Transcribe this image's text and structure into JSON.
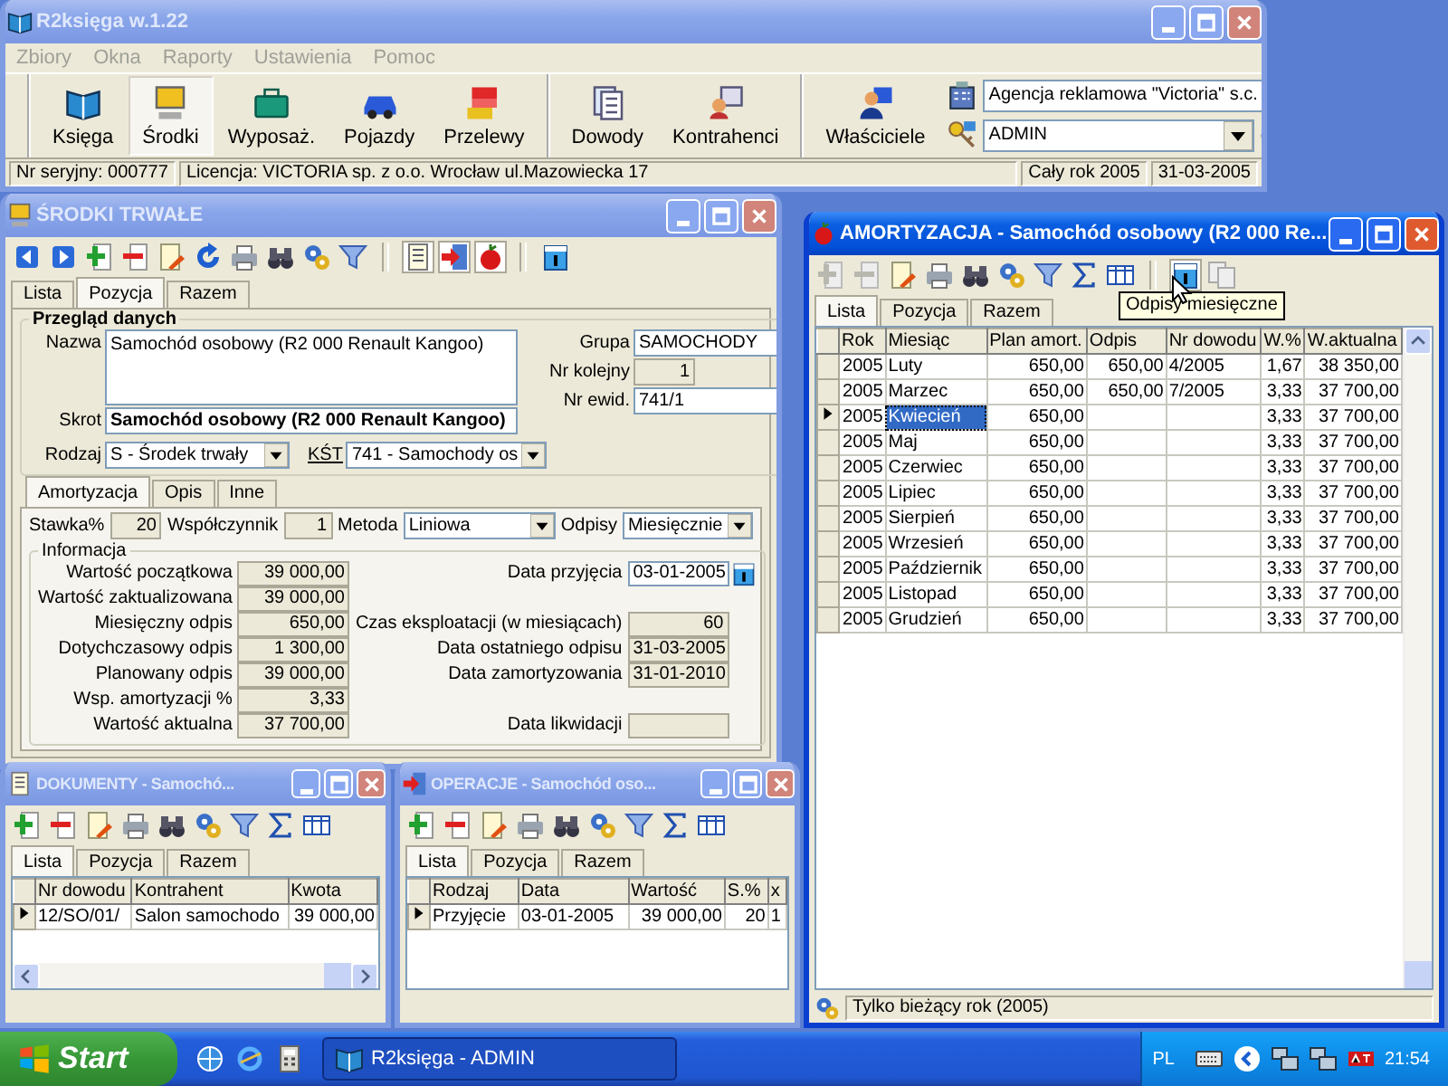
{
  "main_window": {
    "title": "R2księga w.1.22",
    "active": false,
    "menu": [
      {
        "label": "Zbiory",
        "disabled": true
      },
      {
        "label": "Okna",
        "disabled": true
      },
      {
        "label": "Raporty",
        "disabled": true
      },
      {
        "label": "Ustawienia",
        "disabled": true
      },
      {
        "label": "Pomoc",
        "disabled": true
      }
    ],
    "toolbar_groups": [
      [
        {
          "label": "Księga",
          "selected": false
        },
        {
          "label": "Środki",
          "selected": true
        },
        {
          "label": "Wyposaż.",
          "selected": false
        },
        {
          "label": "Pojazdy",
          "selected": false
        },
        {
          "label": "Przelewy",
          "selected": false
        }
      ],
      [
        {
          "label": "Dowody",
          "selected": false
        },
        {
          "label": "Kontrahenci",
          "selected": false
        }
      ],
      [
        {
          "label": "Właściciele",
          "selected": false
        }
      ]
    ],
    "company_select": "Agencja reklamowa \"Victoria\" s.c.",
    "user_select": "ADMIN",
    "status_bar": [
      "Nr seryjny: 000777",
      "Licencja: VICTORIA sp. z o.o. Wrocław ul.Mazowiecka 17",
      "Cały rok 2005",
      "31-03-2005"
    ]
  },
  "srodki_window": {
    "title": "ŚRODKI TRWAŁE",
    "active": false,
    "tabs": [
      {
        "label": "Lista",
        "selected": false
      },
      {
        "label": "Pozycja",
        "selected": true
      },
      {
        "label": "Razem",
        "selected": false
      }
    ],
    "section_title": "Przegląd danych",
    "nazwa": {
      "label": "Nazwa",
      "value": "Samochód osobowy (R2 000 Renault Kangoo)"
    },
    "skrot": {
      "label": "Skrot",
      "value": "Samochód osobowy (R2 000 Renault Kangoo)"
    },
    "grupa": {
      "label": "Grupa",
      "value": "SAMOCHODY"
    },
    "nr_kolejny": {
      "label": "Nr kolejny",
      "value": "1"
    },
    "nr_ewid": {
      "label": "Nr ewid.",
      "value": "741/1"
    },
    "rodzaj": {
      "label": "Rodzaj",
      "value": "S - Środek trwały"
    },
    "kst": {
      "label": "KŚT",
      "value": "741 - Samochody os"
    },
    "inner_tabs": [
      {
        "label": "Amortyzacja",
        "selected": true
      },
      {
        "label": "Opis",
        "selected": false
      },
      {
        "label": "Inne",
        "selected": false
      }
    ],
    "stawka": {
      "label": "Stawka%",
      "value": "20"
    },
    "wspolczynnik": {
      "label": "Współczynnik",
      "value": "1"
    },
    "metoda": {
      "label": "Metoda",
      "value": "Liniowa"
    },
    "odpisy": {
      "label": "Odpisy",
      "value": "Miesięcznie"
    },
    "info_title": "Informacja",
    "info_rows": [
      {
        "left": {
          "label": "Wartość początkowa",
          "value": "39 000,00"
        },
        "right": {
          "kind": "date",
          "label": "Data przyjęcia",
          "value": "03-01-2005"
        }
      },
      {
        "left": {
          "label": "Wartość zaktualizowana",
          "value": "39 000,00"
        }
      },
      {
        "left": {
          "label": "Miesięczny odpis",
          "value": "650,00"
        },
        "right": {
          "kind": "number",
          "label": "Czas eksploatacji (w miesiącach)",
          "value": "60"
        }
      },
      {
        "left": {
          "label": "Dotychczasowy odpis",
          "value": "1 300,00"
        },
        "right": {
          "kind": "text",
          "label": "Data ostatniego odpisu",
          "value": "31-03-2005"
        }
      },
      {
        "left": {
          "label": "Planowany odpis",
          "value": "39 000,00"
        },
        "right": {
          "kind": "text",
          "label": "Data zamortyzowania",
          "value": "31-01-2010"
        }
      },
      {
        "left": {
          "label": "Wsp. amortyzacji %",
          "value": "3,33"
        }
      },
      {
        "left": {
          "label": "Wartość aktualna",
          "value": "37 700,00"
        },
        "right": {
          "kind": "text",
          "label": "Data likwidacji"
        }
      }
    ]
  },
  "amortyzacja_window": {
    "title": "AMORTYZACJA - Samochód osobowy (R2 000 Re...",
    "active": true,
    "tabs": [
      {
        "label": "Lista",
        "selected": true
      },
      {
        "label": "Pozycja",
        "selected": false
      },
      {
        "label": "Razem",
        "selected": false
      }
    ],
    "tooltip": "Odpisy miesięczne",
    "columns": [
      "Rok",
      "Miesiąc",
      "Plan amort.",
      "Odpis",
      "Nr dowodu",
      "W.%",
      "W.aktualna"
    ],
    "rows": [
      {
        "cells": [
          "2005",
          "Luty",
          "650,00",
          "650,00",
          "4/2005",
          "1,67",
          "38 350,00"
        ],
        "current": false,
        "selected": false
      },
      {
        "cells": [
          "2005",
          "Marzec",
          "650,00",
          "650,00",
          "7/2005",
          "3,33",
          "37 700,00"
        ],
        "current": false,
        "selected": false
      },
      {
        "cells": [
          "2005",
          "Kwiecień",
          "650,00",
          "",
          "",
          "3,33",
          "37 700,00"
        ],
        "current": true,
        "selected": true
      },
      {
        "cells": [
          "2005",
          "Maj",
          "650,00",
          "",
          "",
          "3,33",
          "37 700,00"
        ],
        "current": false,
        "selected": false
      },
      {
        "cells": [
          "2005",
          "Czerwiec",
          "650,00",
          "",
          "",
          "3,33",
          "37 700,00"
        ],
        "current": false,
        "selected": false
      },
      {
        "cells": [
          "2005",
          "Lipiec",
          "650,00",
          "",
          "",
          "3,33",
          "37 700,00"
        ],
        "current": false,
        "selected": false
      },
      {
        "cells": [
          "2005",
          "Sierpień",
          "650,00",
          "",
          "",
          "3,33",
          "37 700,00"
        ],
        "current": false,
        "selected": false
      },
      {
        "cells": [
          "2005",
          "Wrzesień",
          "650,00",
          "",
          "",
          "3,33",
          "37 700,00"
        ],
        "current": false,
        "selected": false
      },
      {
        "cells": [
          "2005",
          "Październik",
          "650,00",
          "",
          "",
          "3,33",
          "37 700,00"
        ],
        "current": false,
        "selected": false
      },
      {
        "cells": [
          "2005",
          "Listopad",
          "650,00",
          "",
          "",
          "3,33",
          "37 700,00"
        ],
        "current": false,
        "selected": false
      },
      {
        "cells": [
          "2005",
          "Grudzień",
          "650,00",
          "",
          "",
          "3,33",
          "37 700,00"
        ],
        "current": false,
        "selected": false
      }
    ],
    "status_bar": "Tylko bieżący rok (2005)"
  },
  "dokumenty_window": {
    "title": "DOKUMENTY - Samochó...",
    "active": false,
    "tabs": [
      {
        "label": "Lista",
        "selected": true
      },
      {
        "label": "Pozycja",
        "selected": false
      },
      {
        "label": "Razem",
        "selected": false
      }
    ],
    "columns": [
      "Nr dowodu",
      "Kontrahent",
      "Kwota"
    ],
    "rows": [
      {
        "cells": [
          "12/SO/01/",
          "Salon samochodo",
          "39 000,00"
        ],
        "current": true,
        "selected": false
      }
    ]
  },
  "operacje_window": {
    "title": "OPERACJE - Samochód oso...",
    "active": false,
    "tabs": [
      {
        "label": "Lista",
        "selected": true
      },
      {
        "label": "Pozycja",
        "selected": false
      },
      {
        "label": "Razem",
        "selected": false
      }
    ],
    "columns": [
      "Rodzaj",
      "Data",
      "Wartość",
      "S.%",
      "x"
    ],
    "rows": [
      {
        "cells": [
          "Przyjęcie",
          "03-01-2005",
          "39 000,00",
          "20",
          "1"
        ],
        "current": true,
        "selected": false
      }
    ]
  },
  "taskbar": {
    "start": "Start",
    "tasks": [
      {
        "label": "R2księga - ADMIN",
        "selected": true
      }
    ],
    "language": "PL",
    "clock": "21:54"
  }
}
